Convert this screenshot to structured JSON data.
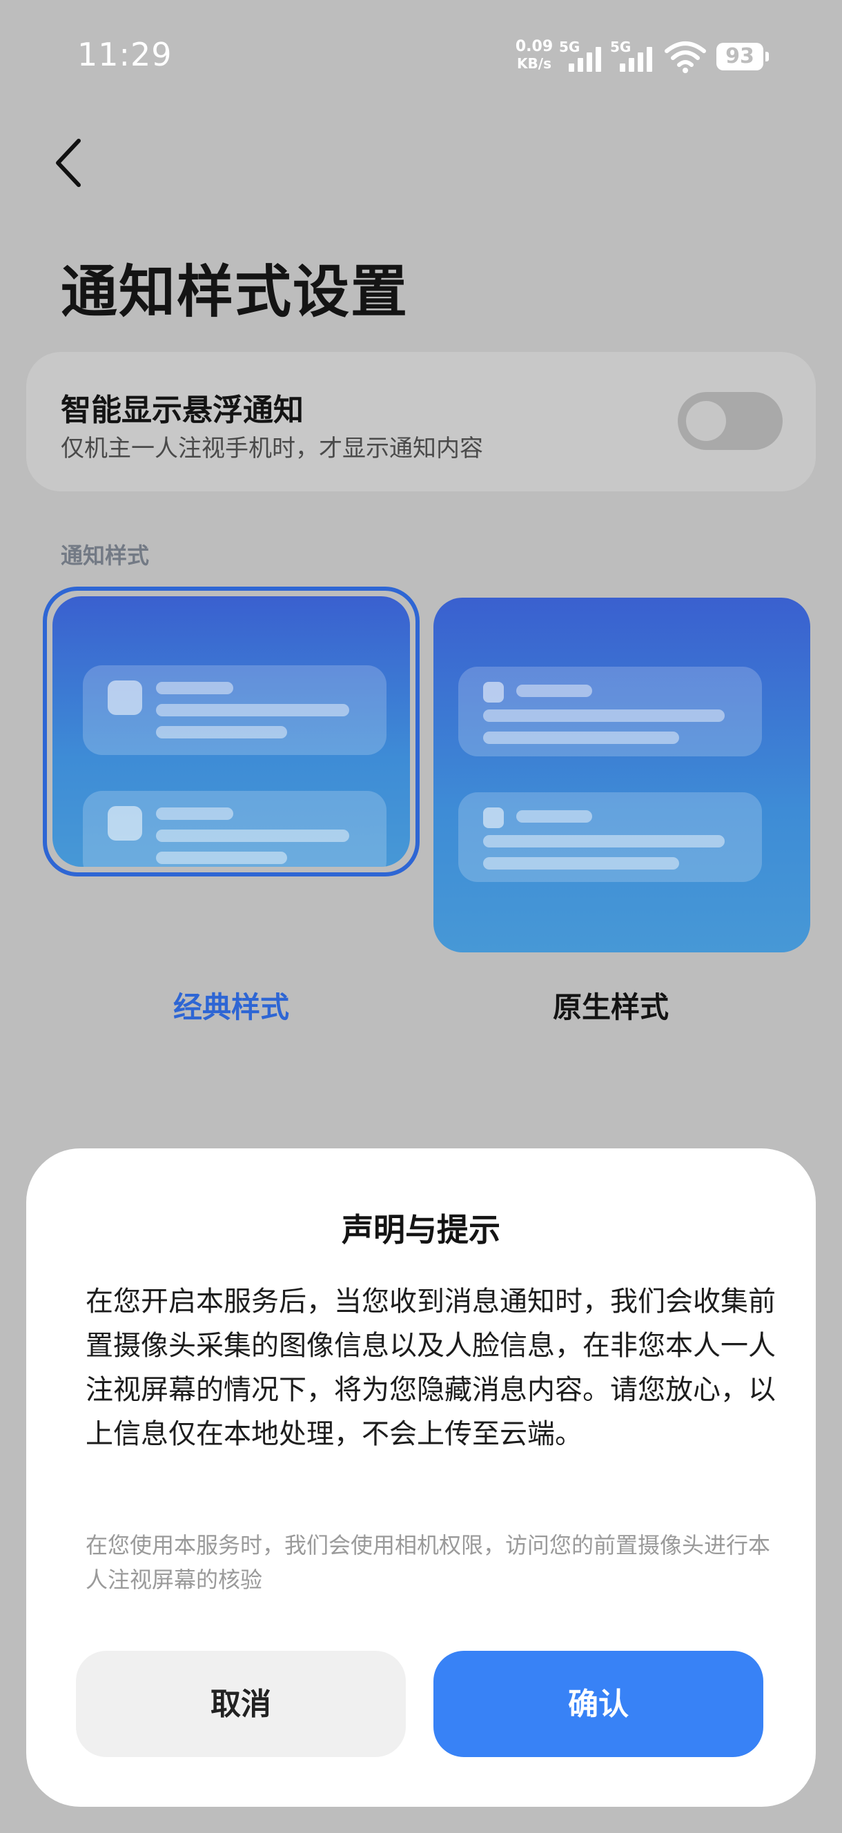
{
  "status_bar": {
    "time": "11:29",
    "net_speed_value": "0.09",
    "net_speed_unit": "KB/s",
    "sim1_type": "5G",
    "sim2_type": "5G",
    "battery": "93"
  },
  "header": {
    "title": "通知样式设置"
  },
  "smart_display": {
    "title": "智能显示悬浮通知",
    "description": "仅机主一人注视手机时，才显示通知内容",
    "toggle_on": false
  },
  "notification_style": {
    "section_label": "通知样式",
    "options": [
      {
        "label": "经典样式",
        "selected": true
      },
      {
        "label": "原生样式",
        "selected": false
      }
    ]
  },
  "dialog": {
    "title": "声明与提示",
    "body": "在您开启本服务后，当您收到消息通知时，我们会收集前置摄像头采集的图像信息以及人脸信息，在非您本人一人注视屏幕的情况下，将为您隐藏消息内容。请您放心，以上信息仅在本地处理，不会上传至云端。",
    "note": "在您使用本服务时，我们会使用相机权限，访问您的前置摄像头进行本人注视屏幕的核验",
    "cancel_label": "取消",
    "confirm_label": "确认"
  },
  "colors": {
    "accent": "#3882f6",
    "selected_label": "#2e66d4",
    "background": "#bdbdbd"
  }
}
